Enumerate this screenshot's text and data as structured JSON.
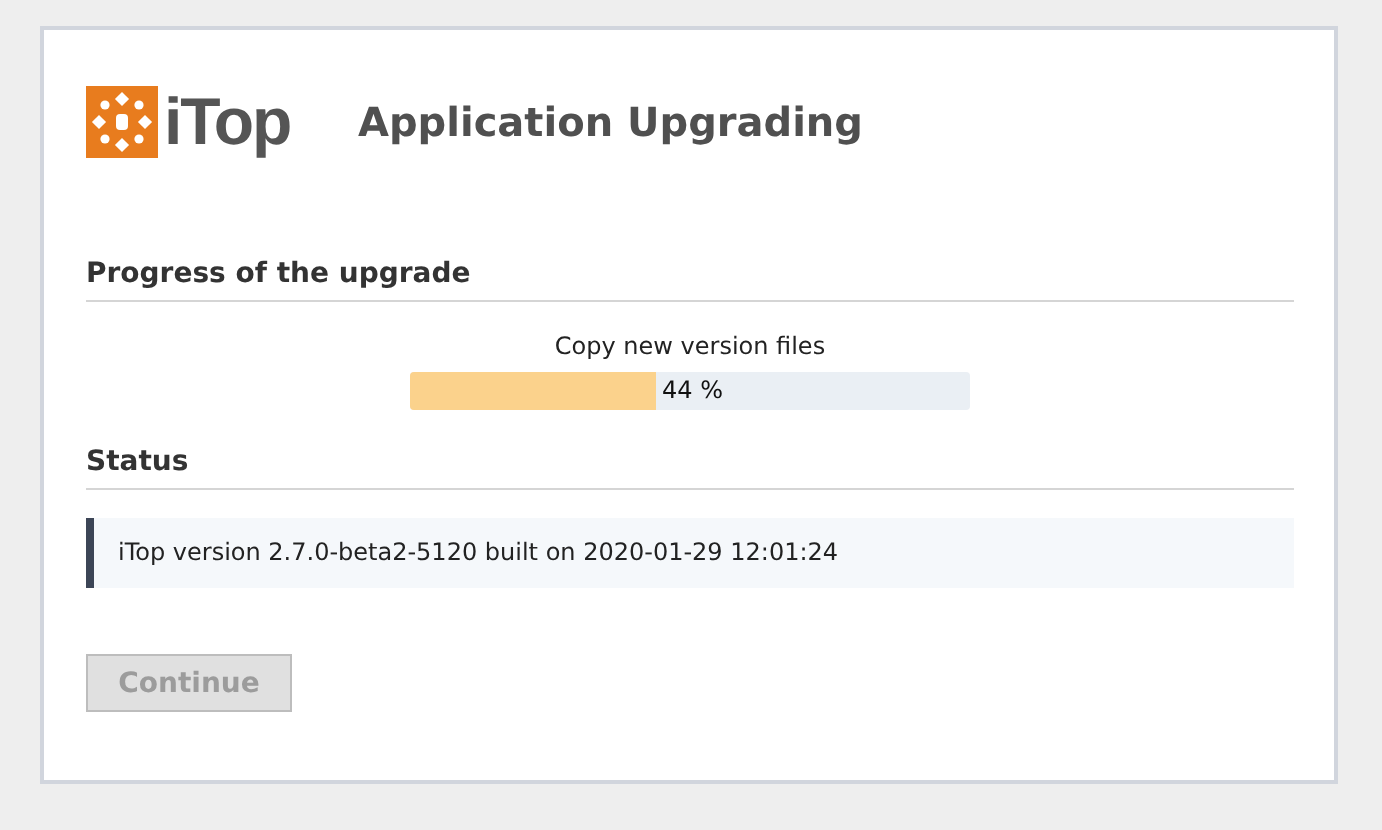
{
  "header": {
    "logo_text": "iTop",
    "title": "Application Upgrading"
  },
  "progress_section": {
    "heading": "Progress of the upgrade",
    "step": "Copy new version files",
    "level": 0.44,
    "reading": "44 %"
  },
  "status_section": {
    "heading": "Status",
    "message": "iTop version 2.7.0-beta2-5120 built on 2020-01-29 12:01:24"
  },
  "continue_button": {
    "label": "Continue",
    "disabled": true
  }
}
